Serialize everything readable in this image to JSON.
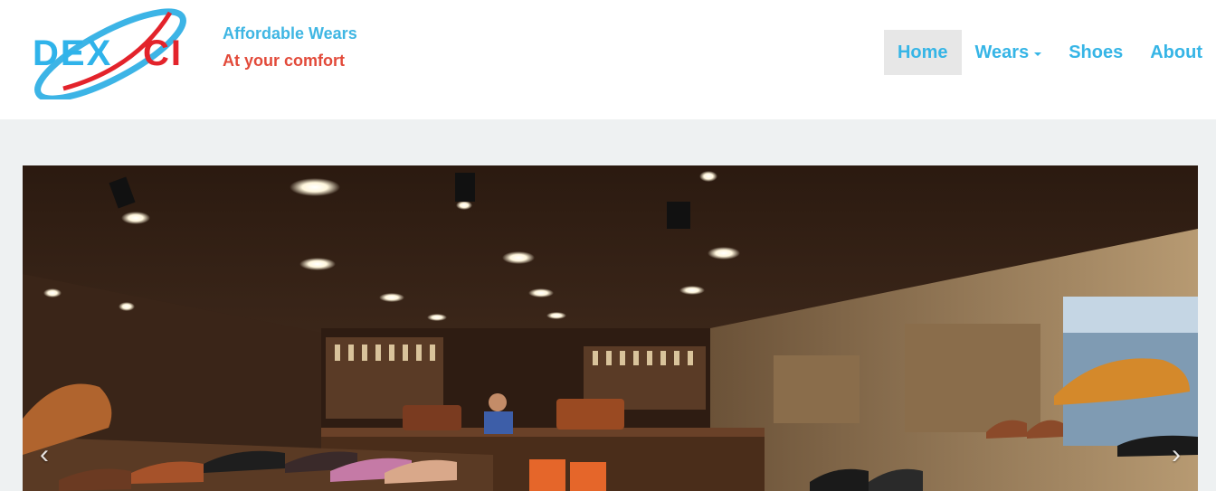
{
  "brand": {
    "logo_text": "DEXCI",
    "tagline_line1": "Affordable Wears",
    "tagline_line2": "At your comfort"
  },
  "nav": {
    "items": [
      {
        "label": "Home",
        "active": true
      },
      {
        "label": "Wears",
        "dropdown": true
      },
      {
        "label": "Shoes"
      },
      {
        "label": "About"
      }
    ]
  },
  "carousel": {
    "prev_icon": "‹",
    "next_icon": "›"
  },
  "colors": {
    "brand_blue": "#36b5e6",
    "brand_red": "#e3232b",
    "nav_active_bg": "#e7e7e7",
    "page_bg": "#eef1f2"
  }
}
